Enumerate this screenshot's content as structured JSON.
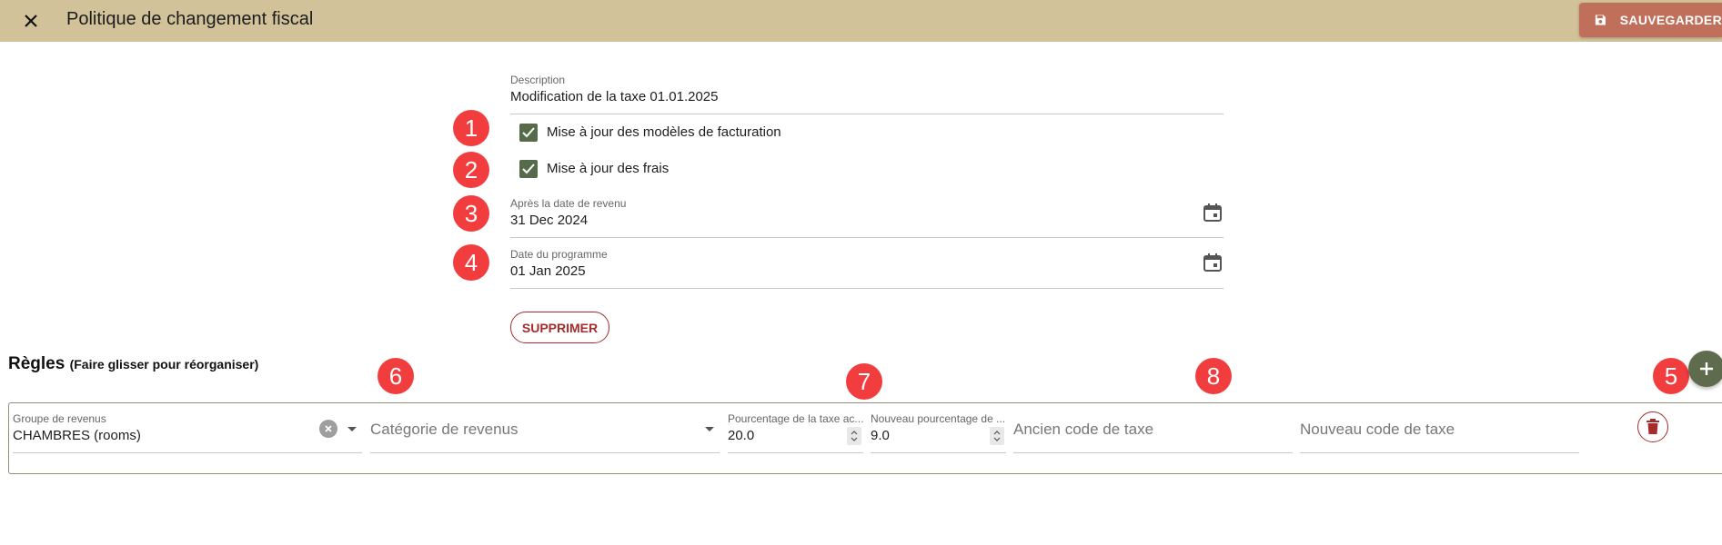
{
  "header": {
    "title": "Politique de changement fiscal",
    "save_label": "SAUVEGARDER",
    "close_icon": "close-icon",
    "save_icon": "floppy-disk-icon"
  },
  "form": {
    "description": {
      "label": "Description",
      "value": "Modification de la taxe 01.01.2025"
    },
    "update_billing_templates": {
      "label": "Mise à jour des modèles de facturation",
      "checked": true
    },
    "update_fees": {
      "label": "Mise à jour des frais",
      "checked": true
    },
    "after_revenue_date": {
      "label": "Après la date de revenu",
      "value": "31 Dec 2024"
    },
    "schedule_date": {
      "label": "Date du programme",
      "value": "01 Jan 2025"
    },
    "delete_label": "SUPPRIMER"
  },
  "markers": [
    "1",
    "2",
    "3",
    "4",
    "5",
    "6",
    "7",
    "8"
  ],
  "rules": {
    "title": "Règles",
    "subtitle": "(Faire glisser pour réorganiser)",
    "items": [
      {
        "revenue_group": {
          "label": "Groupe de revenus",
          "value": "CHAMBRES (rooms)"
        },
        "revenue_category": {
          "placeholder": "Catégorie de revenus"
        },
        "current_tax_pct": {
          "label": "Pourcentage de la taxe ac...",
          "value": "20.0"
        },
        "new_tax_pct": {
          "label": "Nouveau pourcentage de ...",
          "value": "9.0"
        },
        "old_tax_code": {
          "placeholder": "Ancien code de taxe"
        },
        "new_tax_code": {
          "placeholder": "Nouveau code de taxe"
        }
      }
    ]
  },
  "colors": {
    "header_bg": "#d2c29a",
    "save_button": "#c0705a",
    "checkbox": "#556b49",
    "marker": "#f23d3f",
    "danger": "#a72b2b",
    "add_button": "#5f6b4d"
  }
}
